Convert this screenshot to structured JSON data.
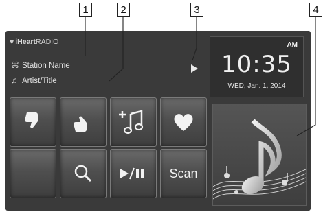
{
  "callouts": [
    "1",
    "2",
    "3",
    "4"
  ],
  "header": {
    "source_logo": "iHeart",
    "source_logo_suffix": "RADIO",
    "station_name": "Station Name",
    "artist_title": "Artist/Title"
  },
  "clock": {
    "ampm": "AM",
    "time": "10:35",
    "date": "WED, Jan. 1, 2014"
  },
  "buttons": {
    "thumbs_down": "thumbs-down-icon",
    "thumbs_up": "thumbs-up-icon",
    "add_music": "add-music-icon",
    "favorite": "heart-icon",
    "blank": "",
    "search": "search-icon",
    "play_pause": "play-pause-icon",
    "scan_label": "Scan"
  },
  "album_art": "music-note-icon",
  "colors": {
    "screen_bg": "#3a3a3a",
    "button_face": "#5a5a5a",
    "text": "#eeeeee"
  }
}
